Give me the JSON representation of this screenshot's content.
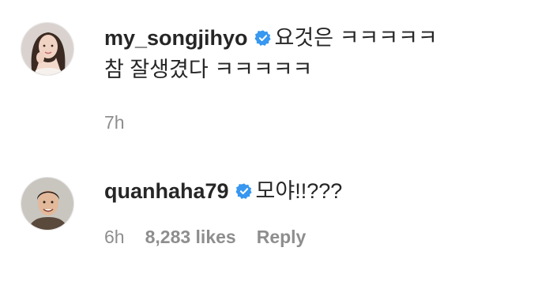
{
  "comments": [
    {
      "username": "my_songjihyo",
      "verified": true,
      "text_line1": "요것은 ㅋㅋㅋㅋㅋ",
      "text_line2": "참 잘생겼다 ㅋㅋㅋㅋㅋ",
      "time": "7h"
    },
    {
      "username": "quanhaha79",
      "verified": true,
      "text": "모야!!???",
      "time": "6h",
      "likes": "8,283 likes",
      "reply_label": "Reply"
    }
  ],
  "colors": {
    "verified_badge": "#3897f0",
    "meta_text": "#8e8e8e",
    "primary_text": "#262626"
  }
}
